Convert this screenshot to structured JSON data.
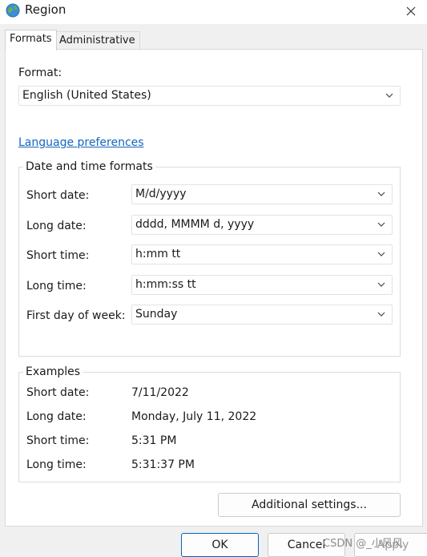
{
  "window": {
    "title": "Region"
  },
  "tabs": [
    {
      "label": "Formats"
    },
    {
      "label": "Administrative"
    }
  ],
  "format": {
    "label": "Format:",
    "value": "English (United States)"
  },
  "language_link": "Language preferences",
  "date_time_formats": {
    "legend": "Date and time formats",
    "rows": [
      {
        "label": "Short date:",
        "value": "M/d/yyyy"
      },
      {
        "label": "Long date:",
        "value": "dddd, MMMM d, yyyy"
      },
      {
        "label": "Short time:",
        "value": "h:mm tt"
      },
      {
        "label": "Long time:",
        "value": "h:mm:ss tt"
      },
      {
        "label": "First day of week:",
        "value": "Sunday"
      }
    ]
  },
  "examples": {
    "legend": "Examples",
    "rows": [
      {
        "label": "Short date:",
        "value": "7/11/2022"
      },
      {
        "label": "Long date:",
        "value": "Monday, July 11, 2022"
      },
      {
        "label": "Short time:",
        "value": "5:31 PM"
      },
      {
        "label": "Long time:",
        "value": "5:31:37 PM"
      }
    ]
  },
  "buttons": {
    "additional": "Additional settings...",
    "ok": "OK",
    "cancel": "Cancel",
    "apply": "Apply"
  },
  "watermark": "CSDN @_小风风",
  "colors": {
    "link": "#1565c0",
    "primary_border": "#0067c0"
  },
  "icons": {
    "app": "globe-icon",
    "close": "close-icon",
    "dropdown": "chevron-down-icon"
  }
}
